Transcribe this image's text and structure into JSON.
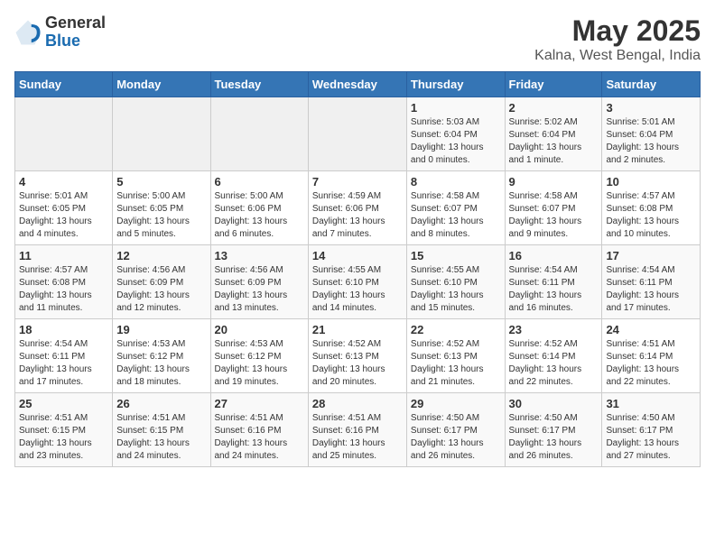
{
  "header": {
    "logo_general": "General",
    "logo_blue": "Blue",
    "month_title": "May 2025",
    "location": "Kalna, West Bengal, India"
  },
  "weekdays": [
    "Sunday",
    "Monday",
    "Tuesday",
    "Wednesday",
    "Thursday",
    "Friday",
    "Saturday"
  ],
  "weeks": [
    [
      {
        "day": "",
        "info": ""
      },
      {
        "day": "",
        "info": ""
      },
      {
        "day": "",
        "info": ""
      },
      {
        "day": "",
        "info": ""
      },
      {
        "day": "1",
        "info": "Sunrise: 5:03 AM\nSunset: 6:04 PM\nDaylight: 13 hours and 0 minutes."
      },
      {
        "day": "2",
        "info": "Sunrise: 5:02 AM\nSunset: 6:04 PM\nDaylight: 13 hours and 1 minute."
      },
      {
        "day": "3",
        "info": "Sunrise: 5:01 AM\nSunset: 6:04 PM\nDaylight: 13 hours and 2 minutes."
      }
    ],
    [
      {
        "day": "4",
        "info": "Sunrise: 5:01 AM\nSunset: 6:05 PM\nDaylight: 13 hours and 4 minutes."
      },
      {
        "day": "5",
        "info": "Sunrise: 5:00 AM\nSunset: 6:05 PM\nDaylight: 13 hours and 5 minutes."
      },
      {
        "day": "6",
        "info": "Sunrise: 5:00 AM\nSunset: 6:06 PM\nDaylight: 13 hours and 6 minutes."
      },
      {
        "day": "7",
        "info": "Sunrise: 4:59 AM\nSunset: 6:06 PM\nDaylight: 13 hours and 7 minutes."
      },
      {
        "day": "8",
        "info": "Sunrise: 4:58 AM\nSunset: 6:07 PM\nDaylight: 13 hours and 8 minutes."
      },
      {
        "day": "9",
        "info": "Sunrise: 4:58 AM\nSunset: 6:07 PM\nDaylight: 13 hours and 9 minutes."
      },
      {
        "day": "10",
        "info": "Sunrise: 4:57 AM\nSunset: 6:08 PM\nDaylight: 13 hours and 10 minutes."
      }
    ],
    [
      {
        "day": "11",
        "info": "Sunrise: 4:57 AM\nSunset: 6:08 PM\nDaylight: 13 hours and 11 minutes."
      },
      {
        "day": "12",
        "info": "Sunrise: 4:56 AM\nSunset: 6:09 PM\nDaylight: 13 hours and 12 minutes."
      },
      {
        "day": "13",
        "info": "Sunrise: 4:56 AM\nSunset: 6:09 PM\nDaylight: 13 hours and 13 minutes."
      },
      {
        "day": "14",
        "info": "Sunrise: 4:55 AM\nSunset: 6:10 PM\nDaylight: 13 hours and 14 minutes."
      },
      {
        "day": "15",
        "info": "Sunrise: 4:55 AM\nSunset: 6:10 PM\nDaylight: 13 hours and 15 minutes."
      },
      {
        "day": "16",
        "info": "Sunrise: 4:54 AM\nSunset: 6:11 PM\nDaylight: 13 hours and 16 minutes."
      },
      {
        "day": "17",
        "info": "Sunrise: 4:54 AM\nSunset: 6:11 PM\nDaylight: 13 hours and 17 minutes."
      }
    ],
    [
      {
        "day": "18",
        "info": "Sunrise: 4:54 AM\nSunset: 6:11 PM\nDaylight: 13 hours and 17 minutes."
      },
      {
        "day": "19",
        "info": "Sunrise: 4:53 AM\nSunset: 6:12 PM\nDaylight: 13 hours and 18 minutes."
      },
      {
        "day": "20",
        "info": "Sunrise: 4:53 AM\nSunset: 6:12 PM\nDaylight: 13 hours and 19 minutes."
      },
      {
        "day": "21",
        "info": "Sunrise: 4:52 AM\nSunset: 6:13 PM\nDaylight: 13 hours and 20 minutes."
      },
      {
        "day": "22",
        "info": "Sunrise: 4:52 AM\nSunset: 6:13 PM\nDaylight: 13 hours and 21 minutes."
      },
      {
        "day": "23",
        "info": "Sunrise: 4:52 AM\nSunset: 6:14 PM\nDaylight: 13 hours and 22 minutes."
      },
      {
        "day": "24",
        "info": "Sunrise: 4:51 AM\nSunset: 6:14 PM\nDaylight: 13 hours and 22 minutes."
      }
    ],
    [
      {
        "day": "25",
        "info": "Sunrise: 4:51 AM\nSunset: 6:15 PM\nDaylight: 13 hours and 23 minutes."
      },
      {
        "day": "26",
        "info": "Sunrise: 4:51 AM\nSunset: 6:15 PM\nDaylight: 13 hours and 24 minutes."
      },
      {
        "day": "27",
        "info": "Sunrise: 4:51 AM\nSunset: 6:16 PM\nDaylight: 13 hours and 24 minutes."
      },
      {
        "day": "28",
        "info": "Sunrise: 4:51 AM\nSunset: 6:16 PM\nDaylight: 13 hours and 25 minutes."
      },
      {
        "day": "29",
        "info": "Sunrise: 4:50 AM\nSunset: 6:17 PM\nDaylight: 13 hours and 26 minutes."
      },
      {
        "day": "30",
        "info": "Sunrise: 4:50 AM\nSunset: 6:17 PM\nDaylight: 13 hours and 26 minutes."
      },
      {
        "day": "31",
        "info": "Sunrise: 4:50 AM\nSunset: 6:17 PM\nDaylight: 13 hours and 27 minutes."
      }
    ]
  ]
}
